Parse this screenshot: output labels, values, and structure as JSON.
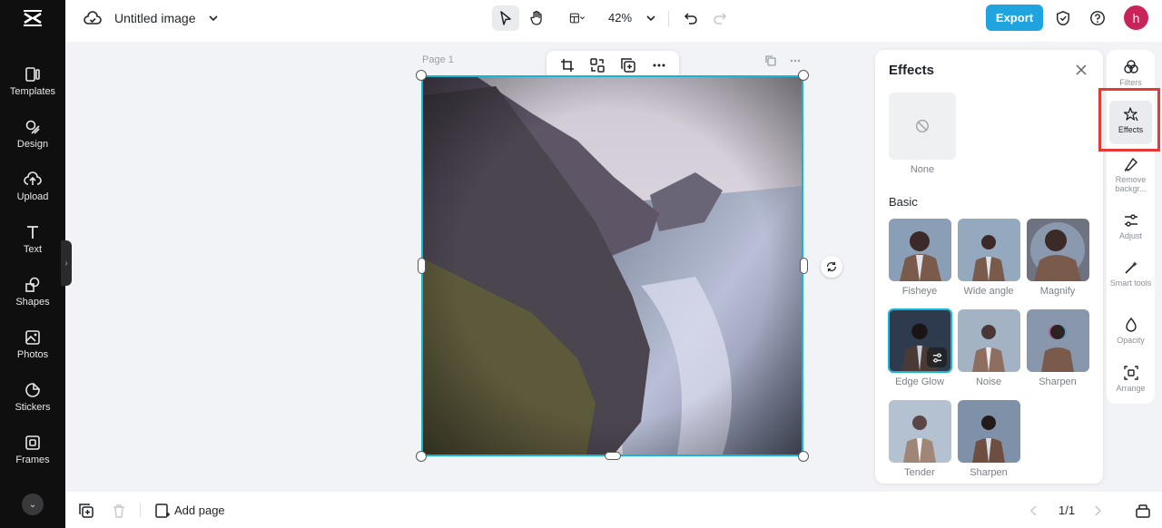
{
  "app": {
    "logo": "capcut-logo"
  },
  "sidebar": {
    "items": [
      {
        "label": "Templates",
        "icon": "templates-icon"
      },
      {
        "label": "Design",
        "icon": "design-icon"
      },
      {
        "label": "Upload",
        "icon": "upload-icon"
      },
      {
        "label": "Text",
        "icon": "text-icon"
      },
      {
        "label": "Shapes",
        "icon": "shapes-icon"
      },
      {
        "label": "Photos",
        "icon": "photos-icon"
      },
      {
        "label": "Stickers",
        "icon": "stickers-icon"
      },
      {
        "label": "Frames",
        "icon": "frames-icon"
      }
    ]
  },
  "header": {
    "doc_title": "Untitled image",
    "zoom": "42%",
    "export_label": "Export",
    "user_initial": "h"
  },
  "canvas": {
    "page_label": "Page 1"
  },
  "effects_panel": {
    "title": "Effects",
    "none_label": "None",
    "section_basic": "Basic",
    "effects": [
      {
        "label": "Fisheye",
        "selected": false
      },
      {
        "label": "Wide angle",
        "selected": false
      },
      {
        "label": "Magnify",
        "selected": false
      },
      {
        "label": "Edge Glow",
        "selected": true
      },
      {
        "label": "Noise",
        "selected": false
      },
      {
        "label": "Sharpen",
        "selected": false
      },
      {
        "label": "Tender",
        "selected": false
      },
      {
        "label": "Sharpen",
        "selected": false
      }
    ]
  },
  "right_rail": {
    "items": [
      {
        "label": "Filters",
        "icon": "filters-icon"
      },
      {
        "label": "Effects",
        "icon": "effects-icon",
        "active": true
      },
      {
        "label": "Remove backgr...",
        "icon": "remove-background-icon"
      },
      {
        "label": "Adjust",
        "icon": "adjust-icon"
      },
      {
        "label": "Smart tools",
        "icon": "smart-tools-icon"
      },
      {
        "label": "Opacity",
        "icon": "opacity-icon"
      },
      {
        "label": "Arrange",
        "icon": "arrange-icon"
      }
    ]
  },
  "footer": {
    "add_page_label": "Add page",
    "page_count": "1/1"
  },
  "colors": {
    "accent": "#16b6d4",
    "export": "#1fa4e0",
    "highlight": "#e53935",
    "avatar": "#c9245a"
  }
}
